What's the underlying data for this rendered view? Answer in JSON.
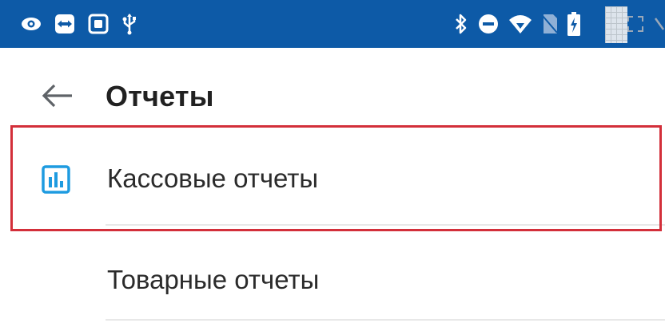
{
  "header": {
    "title": "Отчеты",
    "back_icon": "arrow-left-icon"
  },
  "reports_list": {
    "items": [
      {
        "label": "Кассовые отчеты",
        "icon": "bar-chart-icon",
        "highlighted": true
      },
      {
        "label": "Товарные отчеты",
        "icon": null,
        "highlighted": false
      }
    ]
  },
  "status_bar": {
    "background_color": "#0d5aa7",
    "left_icons": [
      "eye-icon",
      "teamviewer-icon",
      "screen-record-icon",
      "usb-icon"
    ],
    "right_icons": [
      "bluetooth-icon",
      "do-not-disturb-icon",
      "wifi-icon",
      "no-sim-icon",
      "battery-charging-icon",
      "expand-icon",
      "edit-icon"
    ]
  },
  "colors": {
    "accent": "#1e9be0",
    "highlight_border": "#d32f3a",
    "title_text": "#212121"
  }
}
